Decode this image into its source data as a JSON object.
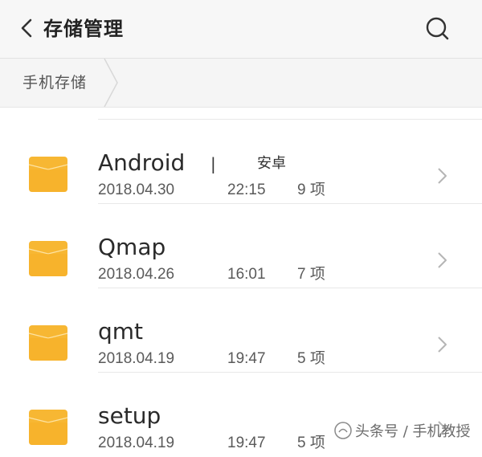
{
  "header": {
    "title": "存储管理",
    "back_icon": "chevron-left-icon",
    "search_icon": "search-icon"
  },
  "breadcrumb": {
    "items": [
      "手机存储"
    ]
  },
  "colors": {
    "folder": "#f7b733",
    "folder_dark": "#f0a81e",
    "header_bg": "#f7f7f7",
    "divider": "#e8e8e8"
  },
  "files": [
    {
      "name": "Android",
      "separator": "|",
      "alias": "安卓",
      "date": "2018.04.30",
      "time": "22:15",
      "count": "9 项"
    },
    {
      "name": "Qmap",
      "date": "2018.04.26",
      "time": "16:01",
      "count": "7 项"
    },
    {
      "name": "qmt",
      "date": "2018.04.19",
      "time": "19:47",
      "count": "5 项"
    },
    {
      "name": "setup",
      "date": "2018.04.19",
      "time": "19:47",
      "count": "5 项"
    }
  ],
  "watermark": {
    "text": "头条号 / 手机教授"
  }
}
